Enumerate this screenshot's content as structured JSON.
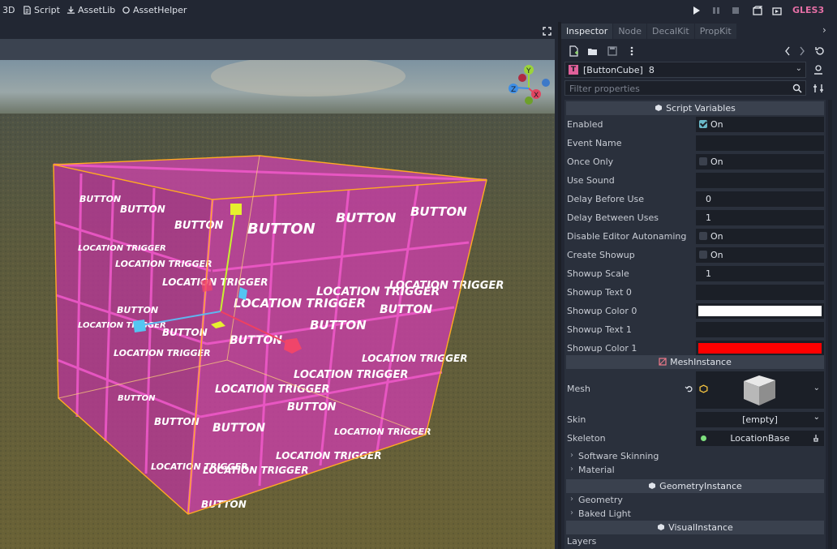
{
  "topbar": {
    "mode_3d": "3D",
    "script": "Script",
    "assetlib": "AssetLib",
    "assethelper": "AssetHelper",
    "renderer": "GLES3"
  },
  "dock": {
    "tabs": [
      "Inspector",
      "Node",
      "DecalKit",
      "PropKit"
    ],
    "object_name": "[ButtonCube]",
    "object_count": "8",
    "filter_placeholder": "Filter properties"
  },
  "sections": {
    "script_variables": "Script Variables",
    "mesh_instance": "MeshInstance",
    "geometry_instance": "GeometryInstance",
    "visual_instance": "VisualInstance"
  },
  "properties": [
    {
      "label": "Enabled",
      "type": "check",
      "checked": true,
      "value": "On"
    },
    {
      "label": "Event Name",
      "type": "text",
      "value": ""
    },
    {
      "label": "Once Only",
      "type": "check",
      "checked": false,
      "value": "On"
    },
    {
      "label": "Use Sound",
      "type": "text",
      "value": ""
    },
    {
      "label": "Delay Before Use",
      "type": "text",
      "value": "0"
    },
    {
      "label": "Delay Between Uses",
      "type": "text",
      "value": "1"
    },
    {
      "label": "Disable Editor Autonaming",
      "type": "check",
      "checked": false,
      "value": "On"
    },
    {
      "label": "Create Showup",
      "type": "check",
      "checked": false,
      "value": "On"
    },
    {
      "label": "Showup Scale",
      "type": "text",
      "value": "1"
    },
    {
      "label": "Showup Text 0",
      "type": "text",
      "value": ""
    },
    {
      "label": "Showup Color 0",
      "type": "color",
      "value": "#ffffff"
    },
    {
      "label": "Showup Text 1",
      "type": "text",
      "value": ""
    },
    {
      "label": "Showup Color 1",
      "type": "color",
      "value": "#ff0000"
    }
  ],
  "mesh": {
    "mesh_label": "Mesh",
    "skin_label": "Skin",
    "skin_value": "[empty]",
    "skeleton_label": "Skeleton",
    "skeleton_value": "LocationBase",
    "software_skinning": "Software Skinning",
    "material": "Material"
  },
  "geometry": {
    "geometry": "Geometry",
    "baked_light": "Baked Light"
  },
  "visual": {
    "layers": "Layers"
  },
  "viewport": {
    "cube_texts": [
      "BUTTON",
      "LOCATION TRIGGER"
    ],
    "gizmo_x": "X",
    "gizmo_y": "Y",
    "gizmo_z": "Z"
  },
  "colors": {
    "accent_pink": "#e46fa5",
    "selection_orange": "#ffaa22",
    "cube_magenta": "#e03ab4"
  }
}
